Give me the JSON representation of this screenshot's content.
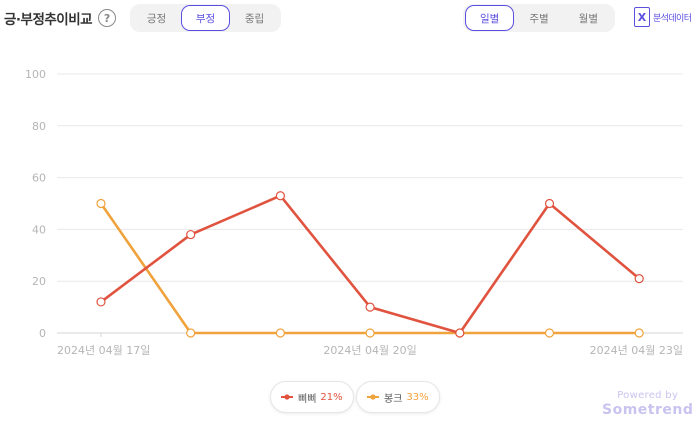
{
  "header": {
    "title": "긍·부정추이비교",
    "help_icon": "help-circle-icon"
  },
  "sentiment_tabs": [
    {
      "label": "긍정",
      "active": false
    },
    {
      "label": "부정",
      "active": true
    },
    {
      "label": "중립",
      "active": false
    }
  ],
  "period_tabs": [
    {
      "label": "일별",
      "active": true
    },
    {
      "label": "주별",
      "active": false
    },
    {
      "label": "월별",
      "active": false
    }
  ],
  "export": {
    "icon": "excel-icon",
    "label": "분석데이터"
  },
  "chart_data": {
    "type": "line",
    "x": [
      "2024-04-17",
      "2024-04-18",
      "2024-04-19",
      "2024-04-20",
      "2024-04-21",
      "2024-04-22",
      "2024-04-23"
    ],
    "x_tick_labels": [
      "2024년 04월 17일",
      "2024년 04월 20일",
      "2024년 04월 23일"
    ],
    "y_ticks": [
      0,
      20,
      40,
      60,
      80,
      100
    ],
    "ylim": [
      0,
      100
    ],
    "grid": true,
    "series": [
      {
        "name": "삐삐",
        "percent": "21%",
        "color": "#e0533f",
        "values": [
          12,
          38,
          53,
          10,
          0,
          50,
          21
        ]
      },
      {
        "name": "봉크",
        "percent": "33%",
        "color": "#f0a23c",
        "values": [
          50,
          0,
          0,
          0,
          0,
          0,
          0
        ]
      }
    ],
    "legend": "bottom-center"
  },
  "branding": {
    "powered_by": "Powered by",
    "name": "Sometrend"
  }
}
